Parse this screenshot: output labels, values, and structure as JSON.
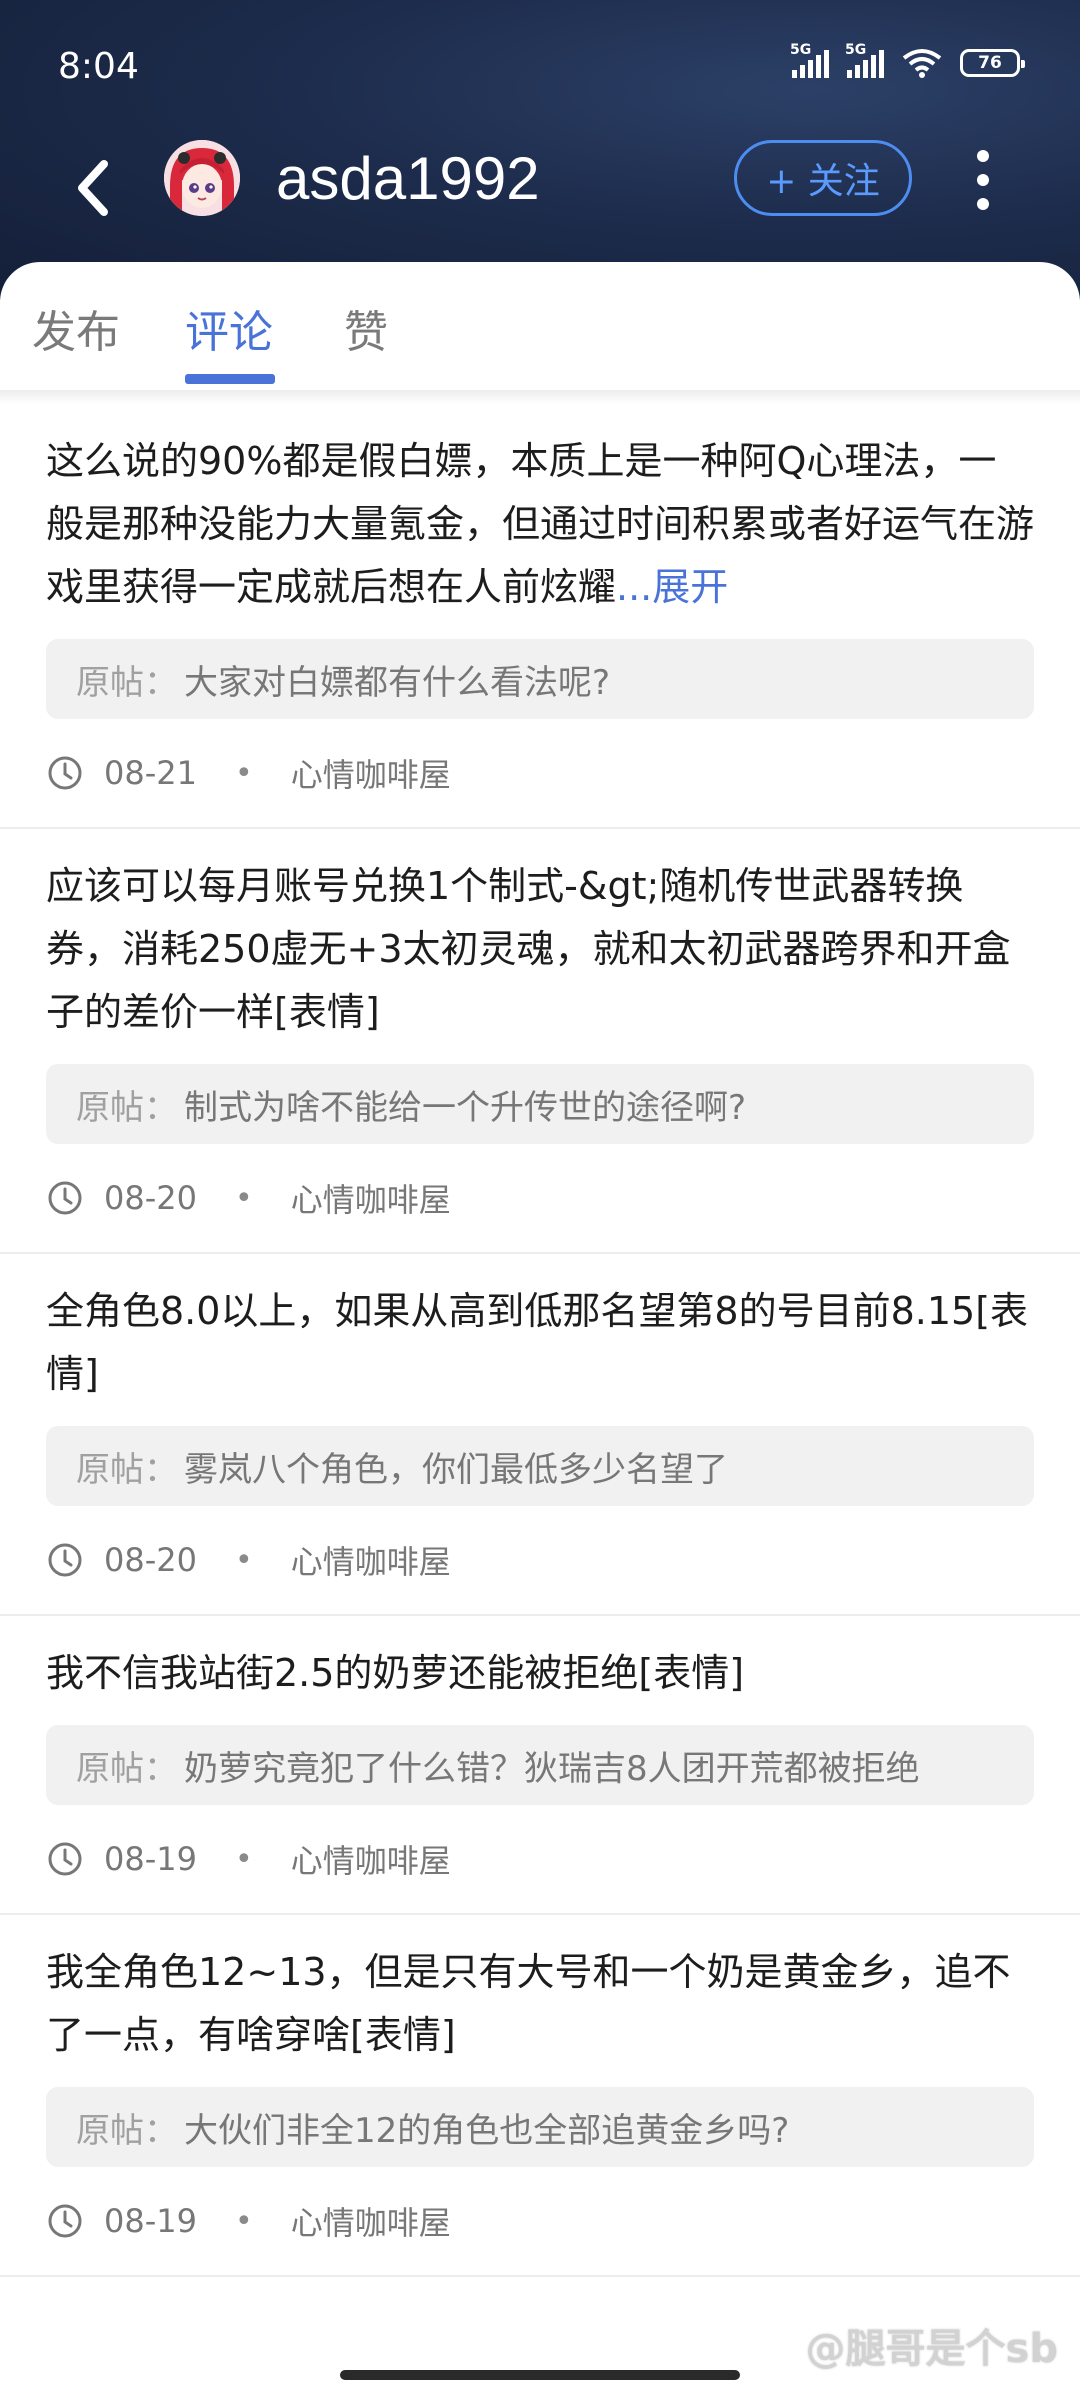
{
  "status_bar": {
    "time": "8:04",
    "signal_1_label": "5G",
    "signal_2_label": "5G",
    "battery": "76"
  },
  "header": {
    "username": "asda1992",
    "follow_label": "+ 关注",
    "accent_color": "#4a73d9"
  },
  "tabs": [
    {
      "label": "发布",
      "active": false
    },
    {
      "label": "评论",
      "active": true
    },
    {
      "label": "赞",
      "active": false
    }
  ],
  "comments": [
    {
      "text": "这么说的90%都是假白嫖，本质上是一种阿Q心理法，一般是那种没能力大量氪金，但通过时间积累或者好运气在游戏里获得一定成就后想在人前炫耀",
      "expand_label": "...展开",
      "original_label": "原帖：",
      "original_title": "大家对白嫖都有什么看法呢?",
      "date": "08-21",
      "forum": "心情咖啡屋"
    },
    {
      "text": "应该可以每月账号兑换1个制式-&gt;随机传世武器转换券，消耗250虚无+3太初灵魂，就和太初武器跨界和开盒子的差价一样[表情]",
      "original_label": "原帖：",
      "original_title": "制式为啥不能给一个升传世的途径啊?",
      "date": "08-20",
      "forum": "心情咖啡屋"
    },
    {
      "text": "全角色8.0以上，如果从高到低那名望第8的号目前8.15[表情]",
      "original_label": "原帖：",
      "original_title": "雾岚八个角色，你们最低多少名望了",
      "date": "08-20",
      "forum": "心情咖啡屋"
    },
    {
      "text": "我不信我站街2.5的奶萝还能被拒绝[表情]",
      "original_label": "原帖：",
      "original_title": "奶萝究竟犯了什么错？狄瑞吉8人团开荒都被拒绝",
      "date": "08-19",
      "forum": "心情咖啡屋"
    },
    {
      "text": "我全角色12~13，但是只有大号和一个奶是黄金乡，追不了一点，有啥穿啥[表情]",
      "original_label": "原帖：",
      "original_title": "大伙们非全12的角色也全部追黄金乡吗?",
      "date": "08-19",
      "forum": "心情咖啡屋"
    }
  ],
  "watermark": "@腿哥是个sb"
}
